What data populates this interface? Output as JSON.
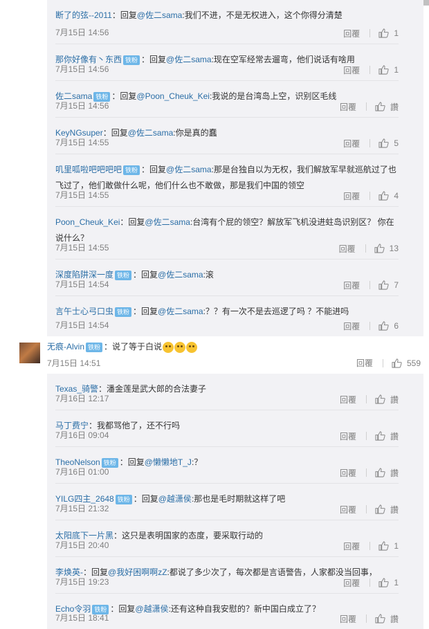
{
  "group1": [
    {
      "user": "断了的弦--2011",
      "sep": "：回复",
      "mention": "@佐二sama",
      "text": ":我们不进，不是无权进入，这个你得分清楚",
      "time": "7月15日 14:56",
      "reply": "回覆",
      "likes": "1"
    },
    {
      "user": "那你好像有丶东西",
      "badges": [
        "铁粉"
      ],
      "sep": "：回复",
      "mention": "@佐二sama",
      "text": ":现在空军经常去遛弯，他们说话有啥用",
      "time": "7月15日 14:56",
      "reply": "回覆",
      "likes": "1"
    },
    {
      "user": "佐二sama",
      "badges": [
        "铁粉"
      ],
      "sep": "：回复",
      "mention": "@Poon_Cheuk_Kei",
      "text": ":我说的是台湾岛上空，识别区毛线",
      "time": "7月15日 14:56",
      "reply": "回覆",
      "likes": "讚"
    },
    {
      "user": "KeyNGsuper",
      "sep": "：回复",
      "mention": "@佐二sama",
      "text": ":你是真的蠢",
      "time": "7月15日 14:55",
      "reply": "回覆",
      "likes": "5"
    },
    {
      "user": "叽里呱啦吧吧吧吧",
      "badges": [
        "铁粉"
      ],
      "sep": "：回复",
      "mention": "@佐二sama",
      "text": ":那是台独自以为无权，我们解放军早就巡航过了也飞过了，他们敢做什么呢，他们什么也不敢做，那是我们中国的领空",
      "time": "7月15日 14:55",
      "reply": "回覆",
      "likes": "4"
    },
    {
      "user": "Poon_Cheuk_Kei",
      "sep": "：回复",
      "mention": "@佐二sama",
      "text": ":台湾有个屁的领空？解放军飞机没进蛀岛识别区？ 你在说什么？",
      "time": "7月15日 14:55",
      "reply": "回覆",
      "likes": "13"
    },
    {
      "user": "深度陷阱深一度",
      "badges": [
        "铁粉"
      ],
      "sep": "：回复",
      "mention": "@佐二sama",
      "text": ":滚",
      "time": "7月15日 14:54",
      "reply": "回覆",
      "likes": "7"
    },
    {
      "user": "言午士心弓口虫",
      "badges": [
        "铁粉"
      ],
      "sep": "：回复",
      "mention": "@佐二sama",
      "text": ":？？有一次不是去巡逻了吗 ？不能进吗",
      "time": "7月15日 14:54",
      "reply": "回覆",
      "likes": "6"
    }
  ],
  "top_reply": {
    "user": "无痕-Alvin",
    "badge": "铁粉",
    "text": "：说了等于白说",
    "time": "7月15日 14:51",
    "reply": "回覆",
    "likes": "559"
  },
  "group2": [
    {
      "user": "Texas_骑警",
      "sep": "：",
      "mention": "",
      "text": "潘金莲是武大郎的合法妻子",
      "time": "7月16日 12:17",
      "reply": "回覆",
      "likes": "讚"
    },
    {
      "user": "马丁费宁",
      "sep": "：",
      "mention": "",
      "text": "我都骂他了，还不行吗",
      "time": "7月16日 09:04",
      "reply": "回覆",
      "likes": "讚"
    },
    {
      "user": "TheoNelson",
      "badges": [
        "铁粉"
      ],
      "sep": "：回复",
      "mention": "@懒懒地T_J",
      "text": ":？",
      "time": "7月16日 01:00",
      "reply": "回覆",
      "likes": "讚"
    },
    {
      "user": "YILG四主_2648",
      "badges": [
        "铁粉"
      ],
      "sep": "：回复",
      "mention": "@越潇侯",
      "text": ":那也是毛时期就这样了吧",
      "time": "7月15日 21:32",
      "reply": "回覆",
      "likes": "讚"
    },
    {
      "user": "太阳底下一片黑",
      "sep": "：",
      "mention": "",
      "text": "这只是表明国家的态度，要采取行动的",
      "time": "7月15日 20:40",
      "reply": "回覆",
      "likes": "1"
    },
    {
      "user": "李焕英-",
      "sep": "：回复",
      "mention": "@我好困啊啊zZ",
      "text": ":都说了多少次了，每次都是言语警告，人家都没当回事，",
      "time": "7月15日 19:23",
      "reply": "回覆",
      "likes": "1"
    },
    {
      "user": "Echo令羽",
      "badges": [
        "铁粉"
      ],
      "sep": "：回复",
      "mention": "@越潇侯",
      "text": ":还有这种自我安慰的？新中国白成立了？",
      "time": "7月15日 18:41",
      "reply": "回覆",
      "likes": "讚"
    }
  ]
}
